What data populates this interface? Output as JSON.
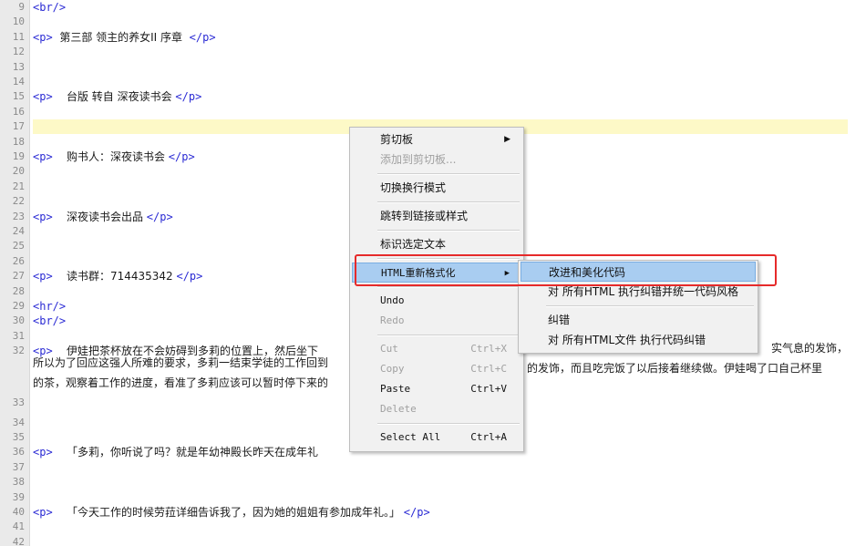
{
  "editor": {
    "lines": [
      {
        "n": "9",
        "parts": [
          {
            "t": "tag",
            "v": "<br/>"
          }
        ]
      },
      {
        "n": "10",
        "parts": []
      },
      {
        "n": "11",
        "parts": [
          {
            "t": "tag",
            "v": "<p>"
          },
          {
            "t": "txt",
            "v": "  第三部 领主的养女II 序章  "
          },
          {
            "t": "tag",
            "v": "</p>"
          }
        ]
      },
      {
        "n": "12",
        "parts": []
      },
      {
        "n": "13",
        "parts": []
      },
      {
        "n": "14",
        "parts": []
      },
      {
        "n": "15",
        "parts": [
          {
            "t": "tag",
            "v": "<p>"
          },
          {
            "t": "txt",
            "v": "    台版 转自 深夜读书会 "
          },
          {
            "t": "tag",
            "v": "</p>"
          }
        ]
      },
      {
        "n": "16",
        "parts": []
      },
      {
        "n": "17",
        "parts": [],
        "highlight": true
      },
      {
        "n": "18",
        "parts": []
      },
      {
        "n": "19",
        "parts": [
          {
            "t": "tag",
            "v": "<p>"
          },
          {
            "t": "txt",
            "v": "    购书人：深夜读书会 "
          },
          {
            "t": "tag",
            "v": "</p>"
          }
        ]
      },
      {
        "n": "20",
        "parts": []
      },
      {
        "n": "21",
        "parts": []
      },
      {
        "n": "22",
        "parts": []
      },
      {
        "n": "23",
        "parts": [
          {
            "t": "tag",
            "v": "<p>"
          },
          {
            "t": "txt",
            "v": "    深夜读书会出品 "
          },
          {
            "t": "tag",
            "v": "</p>"
          }
        ]
      },
      {
        "n": "24",
        "parts": []
      },
      {
        "n": "25",
        "parts": []
      },
      {
        "n": "26",
        "parts": []
      },
      {
        "n": "27",
        "parts": [
          {
            "t": "tag",
            "v": "<p>"
          },
          {
            "t": "txt",
            "v": "    读书群：714435342 "
          },
          {
            "t": "tag",
            "v": "</p>"
          }
        ]
      },
      {
        "n": "28",
        "parts": []
      },
      {
        "n": "29",
        "parts": [
          {
            "t": "tag",
            "v": "<hr/>"
          }
        ]
      },
      {
        "n": "30",
        "parts": [
          {
            "t": "tag",
            "v": "<br/>"
          }
        ]
      },
      {
        "n": "31",
        "parts": []
      },
      {
        "n": "32",
        "parts": [
          {
            "t": "tag",
            "v": "<p>"
          },
          {
            "t": "txt",
            "v": "    伊娃把茶杯放在不会妨碍到多莉的位置上，然后坐下"
          }
        ]
      },
      {
        "n": "",
        "parts": [
          {
            "t": "txt",
            "v": "所以为了回应这强人所难的要求，多莉一结束学徒的工作回到"
          }
        ]
      },
      {
        "n": "",
        "parts": [
          {
            "t": "txt",
            "v": "的茶，观察着工作的进度，看准了多莉应该可以暂时停下来的"
          }
        ]
      },
      {
        "n": "33",
        "parts": []
      },
      {
        "n": "34",
        "parts": []
      },
      {
        "n": "35",
        "parts": []
      },
      {
        "n": "36",
        "parts": [
          {
            "t": "tag",
            "v": "<p>"
          },
          {
            "t": "txt",
            "v": "    「多莉，你听说了吗？就是年幼神殿长昨天在成年礼"
          }
        ]
      },
      {
        "n": "37",
        "parts": []
      },
      {
        "n": "38",
        "parts": []
      },
      {
        "n": "39",
        "parts": []
      },
      {
        "n": "40",
        "parts": [
          {
            "t": "tag",
            "v": "<p>"
          },
          {
            "t": "txt",
            "v": "    「今天工作的时候劳菈详细告诉我了，因为她的姐姐有参加成年礼。」 "
          },
          {
            "t": "tag",
            "v": "</p>"
          }
        ]
      },
      {
        "n": "41",
        "parts": []
      },
      {
        "n": "42",
        "parts": []
      }
    ],
    "right_fragments": {
      "line32a": "实气息的发饰，",
      "line32b": "的发饰，而且吃完饭了以后接着继续做。伊娃喝了口自己杯里"
    }
  },
  "context_menu": {
    "items": [
      {
        "label": "剪切板",
        "submenu": true
      },
      {
        "label": "添加到剪切板...",
        "disabled": true
      },
      {
        "sep": true
      },
      {
        "label": "切换换行模式"
      },
      {
        "sep": true
      },
      {
        "label": "跳转到链接或样式"
      },
      {
        "sep": true
      },
      {
        "label": "标识选定文本"
      },
      {
        "sep": true
      },
      {
        "label": "HTML重新格式化",
        "submenu": true,
        "selected": true
      },
      {
        "sep": true
      },
      {
        "label": "Undo"
      },
      {
        "label": "Redo",
        "disabled": true
      },
      {
        "sep": true
      },
      {
        "label": "Cut",
        "shortcut": "Ctrl+X",
        "disabled": true
      },
      {
        "label": "Copy",
        "shortcut": "Ctrl+C",
        "disabled": true
      },
      {
        "label": "Paste",
        "shortcut": "Ctrl+V"
      },
      {
        "label": "Delete",
        "disabled": true
      },
      {
        "sep": true
      },
      {
        "label": "Select All",
        "shortcut": "Ctrl+A"
      }
    ]
  },
  "submenu": {
    "items": [
      {
        "label": "改进和美化代码",
        "selected": true
      },
      {
        "label": "对 所有HTML 执行纠错并统一代码风格"
      },
      {
        "sep": true
      },
      {
        "label": "纠错"
      },
      {
        "label": "对 所有HTML文件 执行代码纠错"
      }
    ]
  },
  "colors": {
    "tag": "#2a2ad4",
    "highlight": "#fdf9c7",
    "menu_selected": "#a9cdf1",
    "callout": "#e62a2a"
  }
}
